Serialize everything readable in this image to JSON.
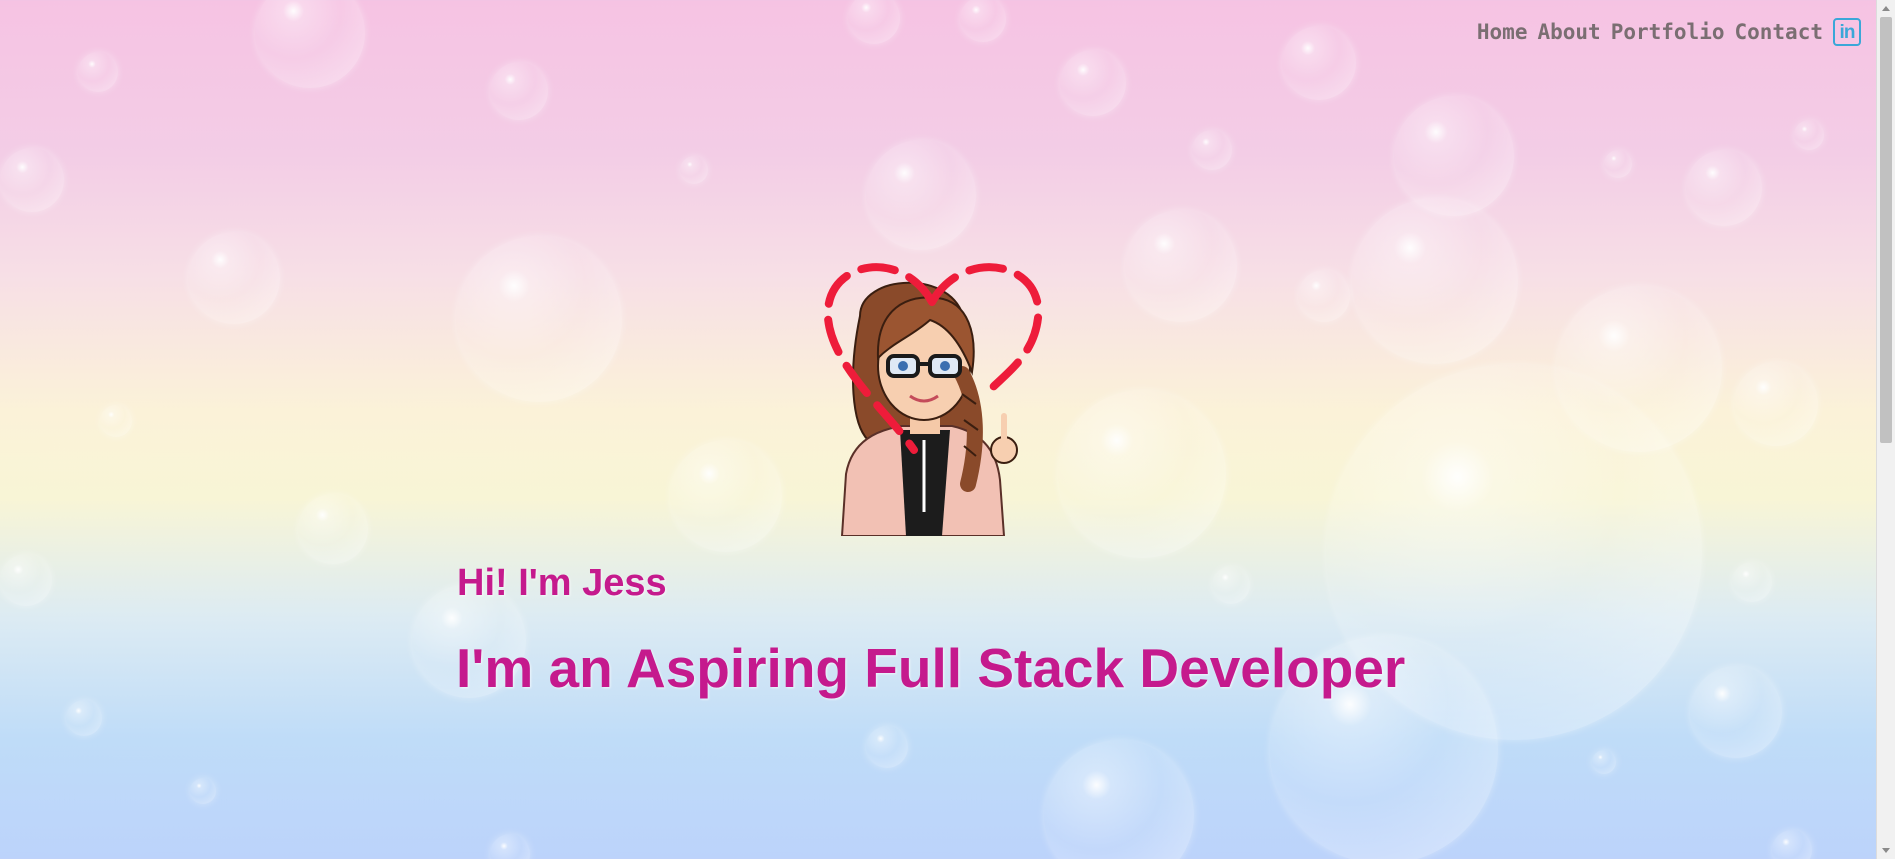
{
  "nav": {
    "items": [
      {
        "label": "Home"
      },
      {
        "label": "About"
      },
      {
        "label": "Portfolio"
      },
      {
        "label": "Contact"
      }
    ],
    "social_icon": "linkedin-icon",
    "social_glyph": "in"
  },
  "hero": {
    "greeting": "Hi! I'm Jess",
    "tagline": "I'm an Aspiring Full Stack Developer",
    "avatar": "bitmoji-avatar-with-heart"
  },
  "colors": {
    "heading": "#c51a8d",
    "nav_text": "#7a6e72",
    "linkedin": "#3aa7d8",
    "heart": "#ee1c3a"
  }
}
